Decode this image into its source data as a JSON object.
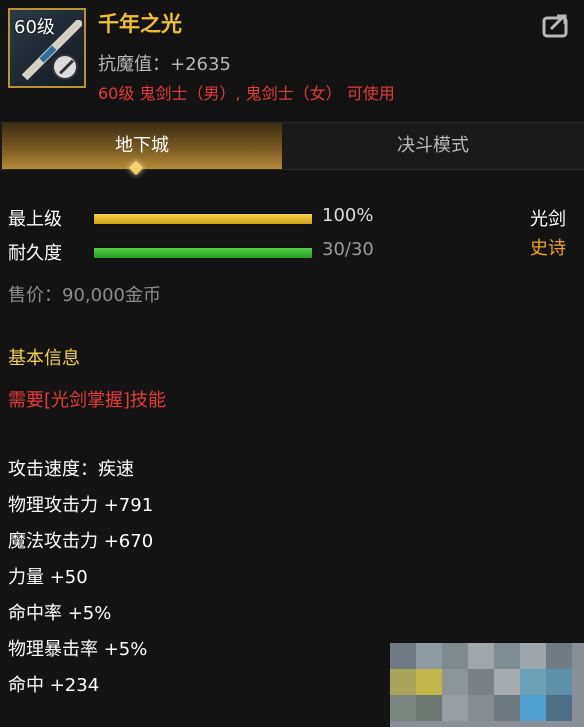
{
  "item": {
    "level_badge": "60级",
    "name": "千年之光",
    "resist_stat": "抗魔值：+2635",
    "restriction": "60级 鬼剑士（男）, 鬼剑士（女） 可使用"
  },
  "tabs": [
    {
      "label": "地下城",
      "active": true
    },
    {
      "label": "决斗模式",
      "active": false
    }
  ],
  "stats": {
    "quality": {
      "label": "最上级",
      "value_text": "100%",
      "fill_percent": 100
    },
    "durability": {
      "label": "耐久度",
      "value_text": "30/30",
      "fill_percent": 100
    },
    "weapon_type": "光剑",
    "rarity": "史诗"
  },
  "price": "售价：90,000金币",
  "basic_info_title": "基本信息",
  "requirement_text": "需要[光剑掌握]技能",
  "attributes": [
    "攻击速度：疾速",
    "物理攻击力 +791",
    "魔法攻击力 +670",
    "力量 +50",
    "命中率 +5%",
    "物理暴击率 +5%",
    "命中 +234"
  ],
  "colors": {
    "title": "#f0c033",
    "restriction": "#e63a3a",
    "rarity_epic": "#f0a51d",
    "section_title": "#f0d150"
  },
  "icons": {
    "item": "lightsaber-icon",
    "blocked": "prohibited-icon",
    "share": "share-icon"
  }
}
